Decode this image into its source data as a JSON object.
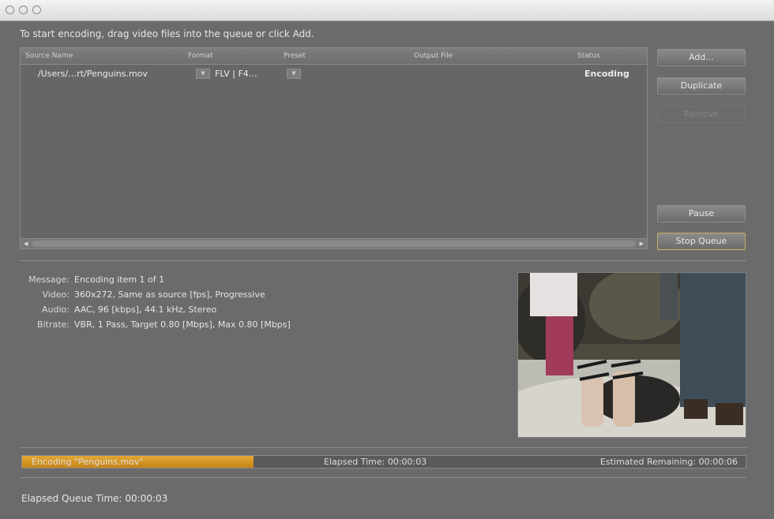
{
  "window": {
    "title": ""
  },
  "instructions": "To start encoding, drag video files into the queue or click Add.",
  "queue": {
    "columns": [
      "Source Name",
      "Format",
      "Preset",
      "Output File",
      "Status"
    ],
    "rows": [
      {
        "source": "/Users/…rt/Penguins.mov",
        "format": "FLV | F4…",
        "preset": "",
        "output": "",
        "status": "Encoding"
      }
    ]
  },
  "buttons": {
    "add": "Add...",
    "duplicate": "Duplicate",
    "remove": "Remove",
    "pause": "Pause",
    "stop_queue": "Stop Queue"
  },
  "info": {
    "message_label": "Message:",
    "message": "Encoding item 1 of 1",
    "video_label": "Video:",
    "video": "360x272, Same as source [fps], Progressive",
    "audio_label": "Audio:",
    "audio": "AAC, 96 [kbps], 44.1 kHz, Stereo",
    "bitrate_label": "Bitrate:",
    "bitrate": "VBR, 1 Pass, Target 0.80 [Mbps], Max 0.80 [Mbps]"
  },
  "progress": {
    "label": "Encoding \"Penguins.mov\"",
    "fraction": 0.32,
    "elapsed": "Elapsed Time: 00:00:03",
    "remaining": "Estimated Remaining: 00:00:06"
  },
  "elapsed_queue_time": "Elapsed Queue Time: 00:00:03"
}
